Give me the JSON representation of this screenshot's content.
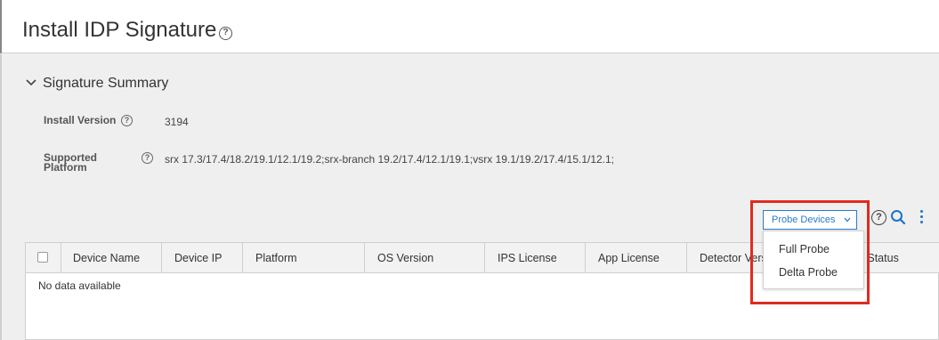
{
  "header": {
    "title": "Install IDP Signature",
    "help_icon": "question-circle-icon"
  },
  "summary": {
    "section_title": "Signature Summary",
    "toggle_icon": "chevron-down-icon",
    "install_version_label": "Install Version",
    "install_version_value": "3194",
    "supported_platform_label_line1": "Supported",
    "supported_platform_label_line2": "Platform",
    "supported_platform_value": "srx 17.3/17.4/18.2/19.1/12.1/19.2;srx-branch 19.2/17.4/12.1/19.1;vsrx 19.1/19.2/17.4/15.1/12.1;"
  },
  "toolbar": {
    "probe_button_label": "Probe Devices",
    "help_icon": "question-circle-icon",
    "search_icon": "search-icon",
    "more_icon": "more-vertical-icon"
  },
  "probe_menu": {
    "items": [
      "Full Probe",
      "Delta Probe"
    ]
  },
  "table": {
    "columns": [
      "Device Name",
      "Device IP",
      "Platform",
      "OS Version",
      "IPS License",
      "App License",
      "Detector Vers",
      "on Status"
    ],
    "empty_text": "No data available"
  },
  "colors": {
    "accent": "#2b7bc9",
    "highlight": "#e02b20",
    "background": "#efefef"
  }
}
